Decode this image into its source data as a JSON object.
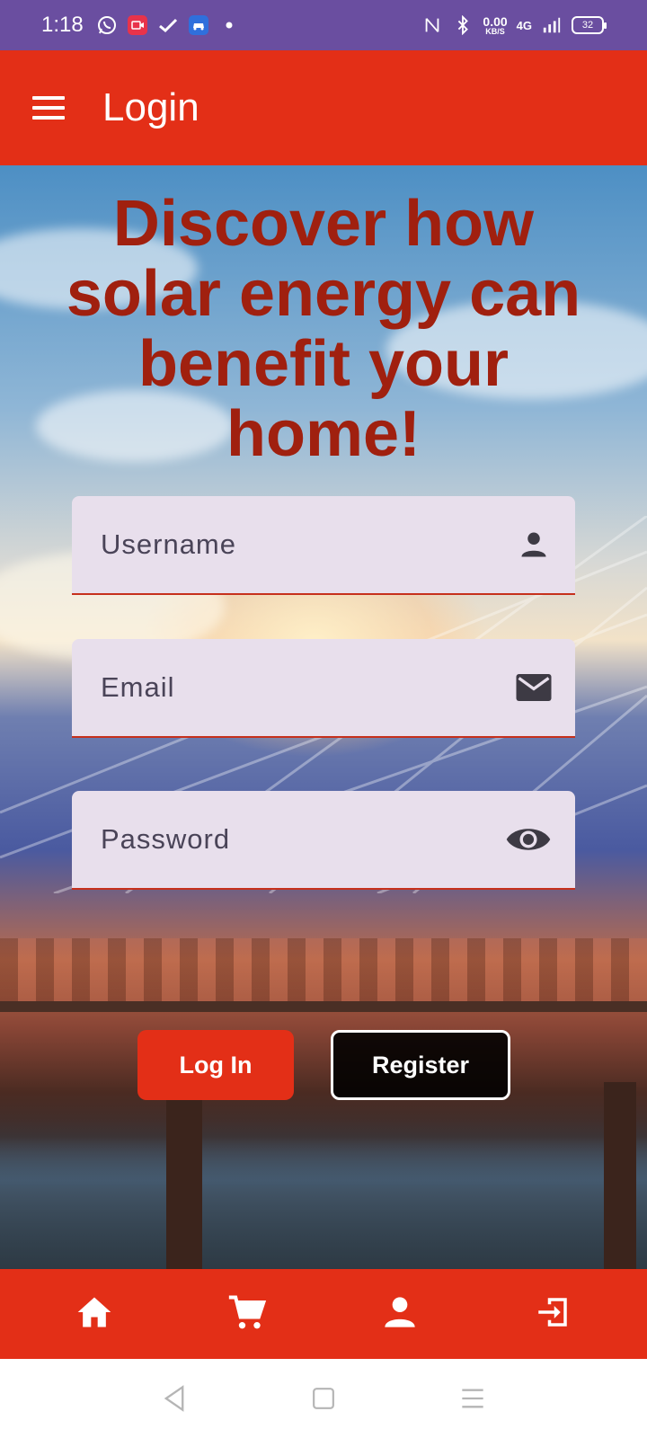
{
  "status_bar": {
    "time": "1:18",
    "speed_value": "0.00",
    "speed_unit": "KB/S",
    "network": "4G",
    "battery": "32",
    "icons": [
      "whatsapp-icon",
      "screen-record-icon",
      "check-icon",
      "car-icon",
      "dot-icon",
      "nfc-icon",
      "bluetooth-icon",
      "signal-icon",
      "battery-icon"
    ]
  },
  "app_bar": {
    "title": "Login",
    "menu_icon": "hamburger-menu-icon"
  },
  "hero": {
    "headline": "Discover how solar energy can benefit your home!"
  },
  "form": {
    "username": {
      "placeholder": "Username",
      "value": "",
      "icon": "person-icon"
    },
    "email": {
      "placeholder": "Email",
      "value": "",
      "icon": "mail-icon"
    },
    "password": {
      "placeholder": "Password",
      "value": "",
      "icon": "eye-icon"
    },
    "login_label": "Log In",
    "register_label": "Register"
  },
  "bottom_nav": {
    "items": [
      {
        "name": "home",
        "icon": "home-icon"
      },
      {
        "name": "cart",
        "icon": "cart-icon"
      },
      {
        "name": "profile",
        "icon": "person-icon"
      },
      {
        "name": "logout",
        "icon": "logout-icon"
      }
    ]
  },
  "colors": {
    "primary": "#e32f17",
    "status_bar": "#6a4ea0",
    "headline": "#a0200f",
    "field_bg": "#e8dfec"
  }
}
